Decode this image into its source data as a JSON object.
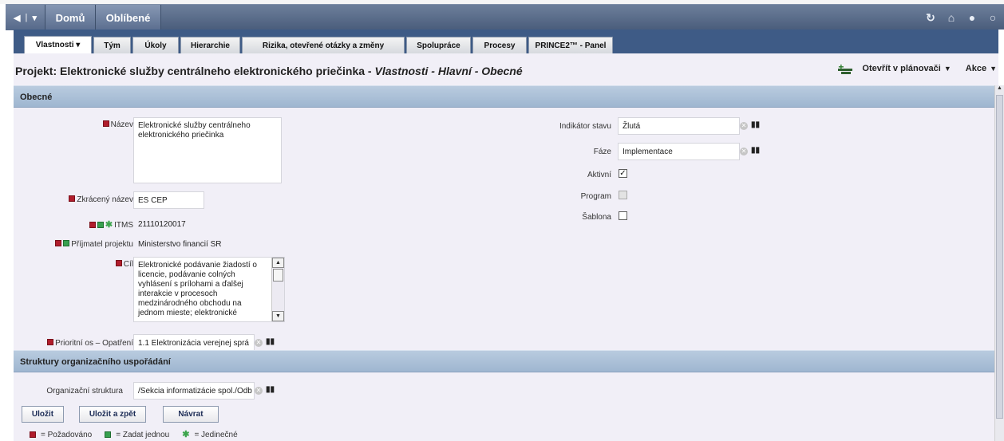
{
  "topnav": {
    "home": "Domů",
    "favorites": "Oblíbené"
  },
  "tabs": [
    {
      "label": "Vlastnosti ▾"
    },
    {
      "label": "Tým"
    },
    {
      "label": "Úkoly"
    },
    {
      "label": "Hierarchie"
    },
    {
      "label": "Rizika, otevřené otázky a změny"
    },
    {
      "label": "Spolupráce"
    },
    {
      "label": "Procesy"
    },
    {
      "label": "PRINCE2™ - Panel"
    }
  ],
  "title": {
    "main": "Projekt: Elektronické služby centrálneho elektronického priečinka - ",
    "italic": "Vlastnosti - Hlavní - Obecné"
  },
  "actions": {
    "planner": "Otevřít v plánovači",
    "action": "Akce"
  },
  "sections": {
    "general": "Obecné",
    "org": "Struktury organizačního uspořádání"
  },
  "fields": {
    "name_label": "Název",
    "name_value": "Elektronické služby centrálneho elektronického priečinka",
    "short_label": "Zkrácený název",
    "short_value": "ES CEP",
    "itms_label": "ITMS",
    "itms_value": "21110120017",
    "recipient_label": "Příjmatel projektu",
    "recipient_value": "Ministerstvo financií SR",
    "goal_label": "Cíl",
    "goal_value": "Elektronické podávanie žiadostí o licencie, podávanie colných vyhlásení s prílohami a ďalšej interakcie v procesoch medzinárodného obchodu na jednom mieste; elektronické",
    "axis_label": "Prioritní os – Opatření",
    "axis_value": "1.1 Elektronizácia verejnej sprá",
    "status_label": "Indikátor stavu",
    "status_value": "Žlutá",
    "phase_label": "Fáze",
    "phase_value": "Implementace",
    "active_label": "Aktivní",
    "program_label": "Program",
    "template_label": "Šablona",
    "org_label": "Organizační struktura",
    "org_value": "/Sekcia informatizácie spol./Odb"
  },
  "checkboxes": {
    "active": true,
    "program": false,
    "template": false
  },
  "buttons": {
    "save": "Uložit",
    "save_back": "Uložit a zpět",
    "back": "Návrat"
  },
  "legend": {
    "required": "= Požadováno",
    "one": "= Zadat jednou",
    "unique": "= Jedinečné"
  },
  "colors": {
    "nav": "#4a5d7c",
    "tabbar": "#3e5b86",
    "section": "#a9bdd4",
    "required": "#b01d2c",
    "once": "#38a04f"
  }
}
